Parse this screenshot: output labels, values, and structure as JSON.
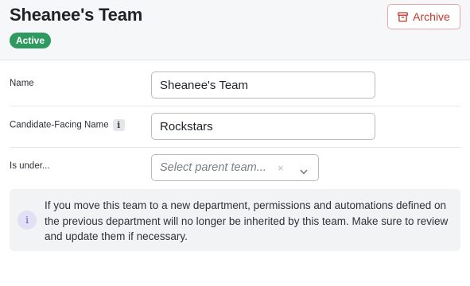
{
  "header": {
    "title": "Sheanee's Team",
    "status_badge": "Active",
    "archive_label": "Archive"
  },
  "form": {
    "name": {
      "label": "Name",
      "value": "Sheanee's Team"
    },
    "candidate_facing_name": {
      "label": "Candidate-Facing Name",
      "info_glyph": "i",
      "value": "Rockstars"
    },
    "is_under": {
      "label": "Is under...",
      "placeholder": "Select parent team...",
      "clear_glyph": "×"
    }
  },
  "notice": {
    "icon_glyph": "i",
    "text": "If you move this team to a new department, permissions and automations defined on the previous department will no longer be inherited by this team. Make sure to review and update them if necessary."
  },
  "colors": {
    "header_bg": "#f6f7f8",
    "badge_green": "#2f9a5f",
    "archive_red": "#c0392b",
    "info_purple": "#5b55b8"
  },
  "icons": {
    "archive": "archive-box-icon",
    "info": "info-icon",
    "clear": "close-icon",
    "dropdown": "chevron-down-icon"
  }
}
